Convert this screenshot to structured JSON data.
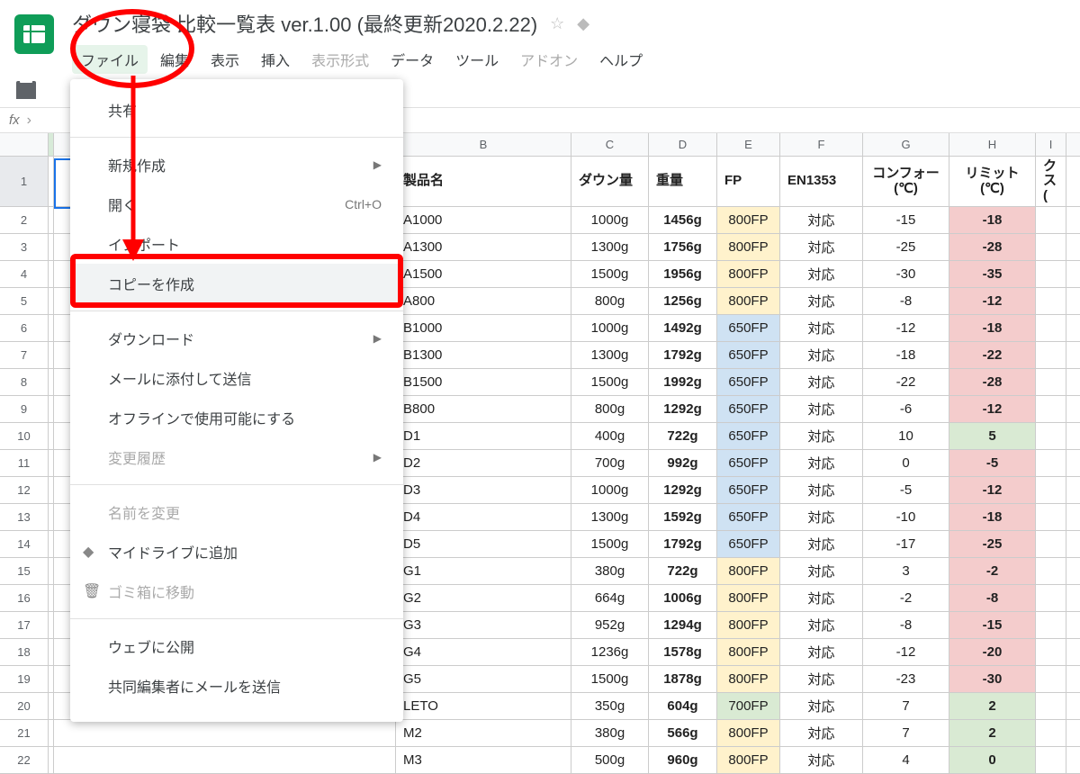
{
  "doc_title": "ダウン寝袋 比較一覧表 ver.1.00 (最終更新2020.2.22)",
  "menu": {
    "file": "ファイル",
    "edit": "編集",
    "view": "表示",
    "insert": "挿入",
    "format": "表示形式",
    "data": "データ",
    "tools": "ツール",
    "addons": "アドオン",
    "help": "ヘルプ"
  },
  "fx_label": "fx",
  "dropdown": {
    "share": "共有",
    "new": "新規作成",
    "open": "開く",
    "open_shortcut": "Ctrl+O",
    "import": "インポート",
    "copy": "コピーを作成",
    "download": "ダウンロード",
    "email_attach": "メールに添付して送信",
    "offline": "オフラインで使用可能にする",
    "history": "変更履歴",
    "rename": "名前を変更",
    "add_drive": "マイドライブに追加",
    "trash": "ゴミ箱に移動",
    "publish": "ウェブに公開",
    "email_collab": "共同編集者にメールを送信"
  },
  "columns": {
    "B": "B",
    "C": "C",
    "D": "D",
    "E": "E",
    "F": "F",
    "G": "G",
    "H": "H",
    "I": "I"
  },
  "headers": {
    "B": "製品名",
    "C": "ダウン量",
    "D": "重量",
    "E": "FP",
    "F": "EN1353",
    "G": "コンフォー\n(℃)",
    "H": "リミット\n(℃)",
    "I": "クス\n("
  },
  "rows": [
    {
      "n": "2",
      "b": "A1000",
      "c": "1000g",
      "d": "1456g",
      "e": "800FP",
      "f": "対応",
      "g": "-15",
      "h": "-18",
      "ec": "fp-800",
      "hc": "limit-neg"
    },
    {
      "n": "3",
      "b": "A1300",
      "c": "1300g",
      "d": "1756g",
      "e": "800FP",
      "f": "対応",
      "g": "-25",
      "h": "-28",
      "ec": "fp-800",
      "hc": "limit-neg"
    },
    {
      "n": "4",
      "b": "A1500",
      "c": "1500g",
      "d": "1956g",
      "e": "800FP",
      "f": "対応",
      "g": "-30",
      "h": "-35",
      "ec": "fp-800",
      "hc": "limit-neg"
    },
    {
      "n": "5",
      "b": "A800",
      "c": "800g",
      "d": "1256g",
      "e": "800FP",
      "f": "対応",
      "g": "-8",
      "h": "-12",
      "ec": "fp-800",
      "hc": "limit-neg"
    },
    {
      "n": "6",
      "b": "B1000",
      "c": "1000g",
      "d": "1492g",
      "e": "650FP",
      "f": "対応",
      "g": "-12",
      "h": "-18",
      "ec": "fp-650",
      "hc": "limit-neg"
    },
    {
      "n": "7",
      "b": "B1300",
      "c": "1300g",
      "d": "1792g",
      "e": "650FP",
      "f": "対応",
      "g": "-18",
      "h": "-22",
      "ec": "fp-650",
      "hc": "limit-neg"
    },
    {
      "n": "8",
      "b": "B1500",
      "c": "1500g",
      "d": "1992g",
      "e": "650FP",
      "f": "対応",
      "g": "-22",
      "h": "-28",
      "ec": "fp-650",
      "hc": "limit-neg"
    },
    {
      "n": "9",
      "b": "B800",
      "c": "800g",
      "d": "1292g",
      "e": "650FP",
      "f": "対応",
      "g": "-6",
      "h": "-12",
      "ec": "fp-650",
      "hc": "limit-neg"
    },
    {
      "n": "10",
      "b": "D1",
      "c": "400g",
      "d": "722g",
      "e": "650FP",
      "f": "対応",
      "g": "10",
      "h": "5",
      "ec": "fp-650",
      "hc": "limit-pos"
    },
    {
      "n": "11",
      "b": "D2",
      "c": "700g",
      "d": "992g",
      "e": "650FP",
      "f": "対応",
      "g": "0",
      "h": "-5",
      "ec": "fp-650",
      "hc": "limit-neg"
    },
    {
      "n": "12",
      "b": "D3",
      "c": "1000g",
      "d": "1292g",
      "e": "650FP",
      "f": "対応",
      "g": "-5",
      "h": "-12",
      "ec": "fp-650",
      "hc": "limit-neg"
    },
    {
      "n": "13",
      "b": "D4",
      "c": "1300g",
      "d": "1592g",
      "e": "650FP",
      "f": "対応",
      "g": "-10",
      "h": "-18",
      "ec": "fp-650",
      "hc": "limit-neg"
    },
    {
      "n": "14",
      "b": "D5",
      "c": "1500g",
      "d": "1792g",
      "e": "650FP",
      "f": "対応",
      "g": "-17",
      "h": "-25",
      "ec": "fp-650",
      "hc": "limit-neg"
    },
    {
      "n": "15",
      "b": "G1",
      "c": "380g",
      "d": "722g",
      "e": "800FP",
      "f": "対応",
      "g": "3",
      "h": "-2",
      "ec": "fp-800",
      "hc": "limit-neg"
    },
    {
      "n": "16",
      "b": "G2",
      "c": "664g",
      "d": "1006g",
      "e": "800FP",
      "f": "対応",
      "g": "-2",
      "h": "-8",
      "ec": "fp-800",
      "hc": "limit-neg"
    },
    {
      "n": "17",
      "b": "G3",
      "c": "952g",
      "d": "1294g",
      "e": "800FP",
      "f": "対応",
      "g": "-8",
      "h": "-15",
      "ec": "fp-800",
      "hc": "limit-neg"
    },
    {
      "n": "18",
      "b": "G4",
      "c": "1236g",
      "d": "1578g",
      "e": "800FP",
      "f": "対応",
      "g": "-12",
      "h": "-20",
      "ec": "fp-800",
      "hc": "limit-neg"
    },
    {
      "n": "19",
      "b": "G5",
      "c": "1500g",
      "d": "1878g",
      "e": "800FP",
      "f": "対応",
      "g": "-23",
      "h": "-30",
      "ec": "fp-800",
      "hc": "limit-neg"
    },
    {
      "n": "20",
      "b": "LETO",
      "c": "350g",
      "d": "604g",
      "e": "700FP",
      "f": "対応",
      "g": "7",
      "h": "2",
      "ec": "fp-700",
      "hc": "limit-pos"
    },
    {
      "n": "21",
      "b": "M2",
      "c": "380g",
      "d": "566g",
      "e": "800FP",
      "f": "対応",
      "g": "7",
      "h": "2",
      "ec": "fp-800",
      "hc": "limit-pos"
    },
    {
      "n": "22",
      "b": "M3",
      "c": "500g",
      "d": "960g",
      "e": "800FP",
      "f": "対応",
      "g": "4",
      "h": "0",
      "ec": "fp-800",
      "hc": "limit-pos"
    }
  ]
}
